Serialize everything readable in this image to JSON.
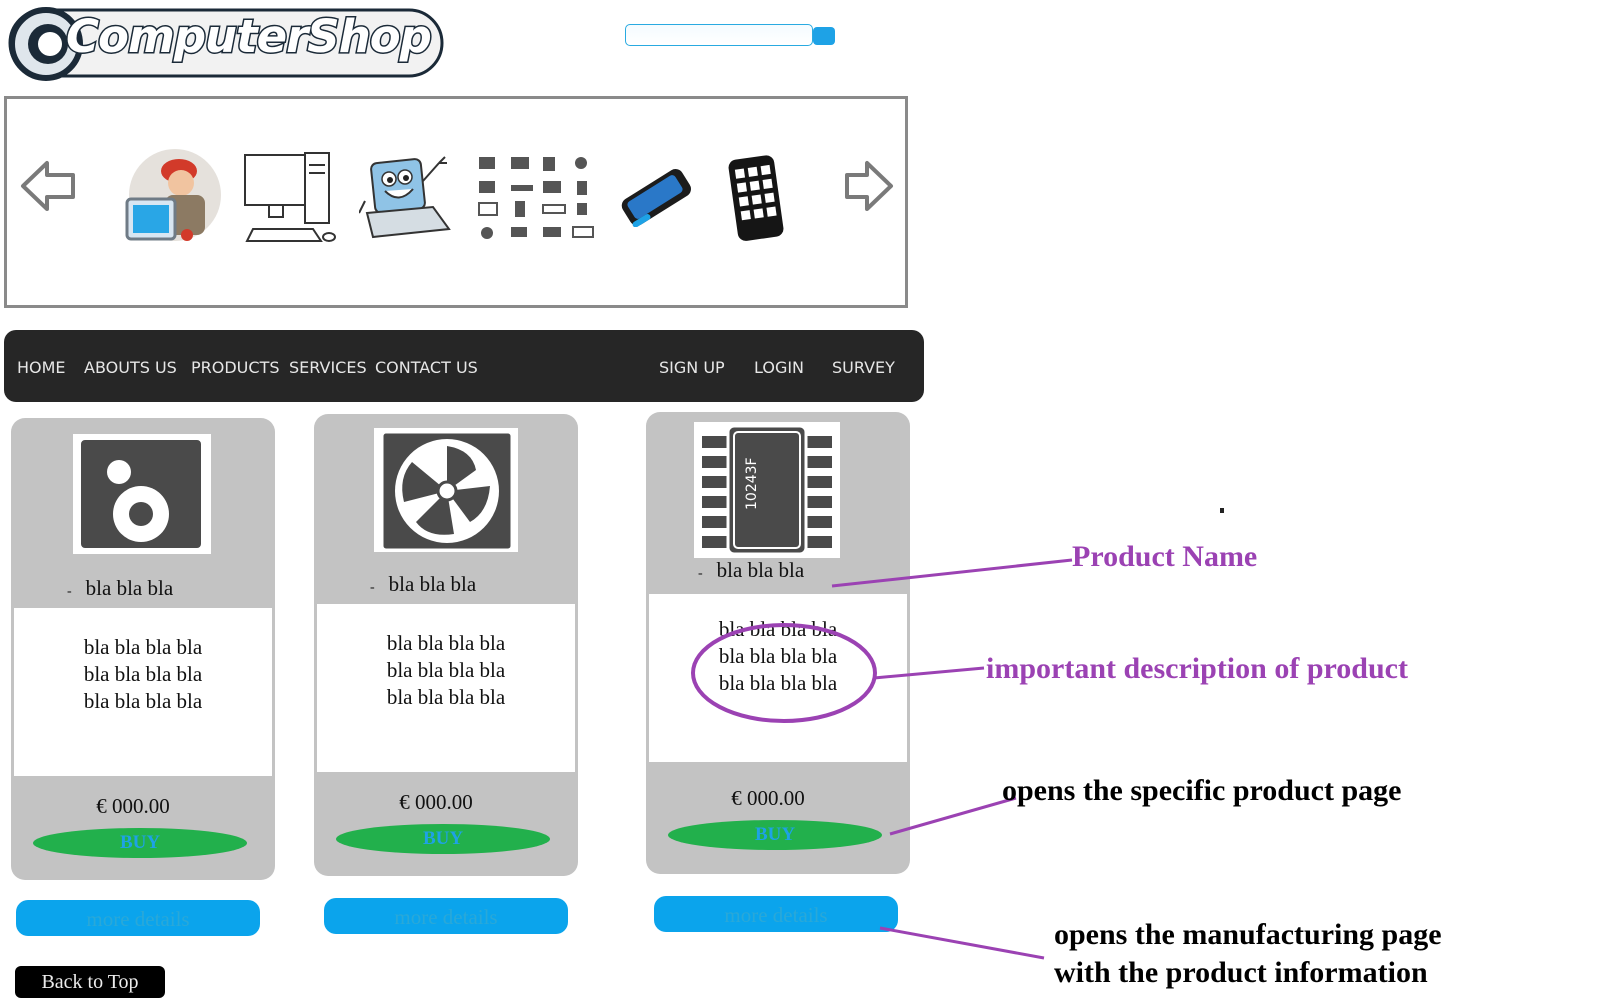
{
  "header": {
    "logo_text": "ComputerShop",
    "search_placeholder": ""
  },
  "slider": {
    "prev_icon": "arrow-left-icon",
    "next_icon": "arrow-right-icon",
    "images": [
      "technician",
      "desktop-computer",
      "laptop-mascot",
      "hardware-icons",
      "smartphone",
      "tablet"
    ]
  },
  "nav": {
    "left": [
      "HOME",
      "ABOUTS US",
      "PRODUCTS",
      "SERVICES",
      "CONTACT US"
    ],
    "right": [
      "SIGN UP",
      "LOGIN",
      "SURVEY"
    ]
  },
  "products": [
    {
      "icon": "speaker-icon",
      "dash": "-",
      "name": "bla bla bla",
      "description": [
        "bla bla bla bla",
        "bla bla bla bla",
        "bla bla bla bla"
      ],
      "price": "€ 000.00",
      "buy_label": "BUY",
      "details_label": "more details"
    },
    {
      "icon": "fan-icon",
      "dash": "-",
      "name": "bla bla bla",
      "description": [
        "bla bla bla bla",
        "bla bla bla bla",
        "bla bla bla bla"
      ],
      "price": "€ 000.00",
      "buy_label": "BUY",
      "details_label": "more details"
    },
    {
      "icon": "chip-icon",
      "chip_label": "10243F",
      "dash": "-",
      "name": "bla bla bla",
      "description": [
        "bla bla bla bla",
        "bla bla bla bla",
        "bla bla bla bla"
      ],
      "price": "€ 000.00",
      "buy_label": "BUY",
      "details_label": "more details"
    }
  ],
  "back_to_top": "Back to Top",
  "annotations": {
    "product_name": "Product Name",
    "description": "important description of product",
    "buy": "opens the specific product page",
    "details_line1": "opens the manufacturing page",
    "details_line2": "with the product information"
  },
  "colors": {
    "accent_blue": "#0ba4ec",
    "buy_green": "#22b04c",
    "nav_bg": "#262626",
    "annotation_purple": "#9b42b3",
    "card_bg": "#c3c3c3"
  }
}
